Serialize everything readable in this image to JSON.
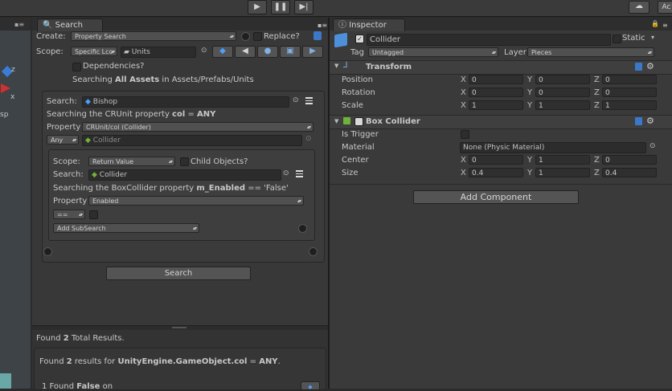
{
  "toolbar": {
    "play_icon": "play-icon",
    "pause_icon": "pause-icon",
    "step_icon": "step-icon",
    "account_label": "Ac"
  },
  "search": {
    "tab_label": "Search",
    "create_label": "Create:",
    "create_value": "Property Search",
    "replace_label": "Replace?",
    "scope_label": "Scope:",
    "scope_value": "Specific Lcc",
    "scope_asset": "Units",
    "dependencies_label": "Dependencies?",
    "searching_line": {
      "prefix": "Searching ",
      "all_assets": "All Assets",
      "mid": " in ",
      "path": "Assets/Prefabs/Units"
    },
    "outer": {
      "search_label": "Search:",
      "search_value": "Bishop",
      "searching_prefix": "Searching the CRUnit property ",
      "searching_property": "col",
      "searching_equals": " = ",
      "searching_value": "ANY",
      "property_label": "Property",
      "property_value": "CRUnit/col (Collider)",
      "any_value": "Any",
      "collider_field": "Collider"
    },
    "inner": {
      "scope_label": "Scope:",
      "scope_value": "Return Value",
      "child_objects_label": "Child Objects?",
      "search_label": "Search:",
      "search_value": "Collider",
      "searching_prefix": "Searching the BoxCollider property ",
      "searching_property": "m_Enabled",
      "searching_rest": " == 'False'",
      "property_label": "Property",
      "property_value": "Enabled",
      "op_value": "==",
      "add_subsearch": "Add SubSearch"
    },
    "search_button": "Search"
  },
  "results": {
    "found_total_prefix": "Found ",
    "found_total_count": "2",
    "found_total_suffix": " Total Results.",
    "found_line_prefix": "Found ",
    "found_line_count": "2",
    "found_line_mid": " results for ",
    "found_line_target": "UnityEngine.GameObject.col",
    "found_line_equals": " = ",
    "found_line_value": "ANY",
    "found_line_end": ".",
    "row_prefix": "1 Found ",
    "row_value": "False",
    "row_suffix": " on"
  },
  "inspector": {
    "tab_label": "Inspector",
    "object_name": "Collider",
    "static_label": "Static",
    "tag_label": "Tag",
    "tag_value": "Untagged",
    "layer_label": "Layer",
    "layer_value": "Pieces",
    "transform": {
      "title": "Transform",
      "rows": [
        {
          "label": "Position",
          "x": "0",
          "y": "0",
          "z": "0"
        },
        {
          "label": "Rotation",
          "x": "0",
          "y": "0",
          "z": "0"
        },
        {
          "label": "Scale",
          "x": "1",
          "y": "1",
          "z": "1"
        }
      ]
    },
    "box_collider": {
      "title": "Box Collider",
      "is_trigger_label": "Is Trigger",
      "material_label": "Material",
      "material_value": "None (Physic Material)",
      "rows": [
        {
          "label": "Center",
          "x": "0",
          "y": "1",
          "z": "0"
        },
        {
          "label": "Size",
          "x": "0.4",
          "y": "1",
          "z": "0.4"
        }
      ]
    },
    "axes": {
      "x": "X",
      "y": "Y",
      "z": "Z"
    },
    "add_component": "Add Component"
  },
  "scene": {
    "axis_z": "z",
    "axis_x": "x",
    "persp_label": "sp"
  },
  "colors": {
    "panel_bg": "#383838",
    "dark_bg": "#2b2b2b",
    "accent_blue": "#3b78c8",
    "collider_green": "#6fb33a"
  }
}
